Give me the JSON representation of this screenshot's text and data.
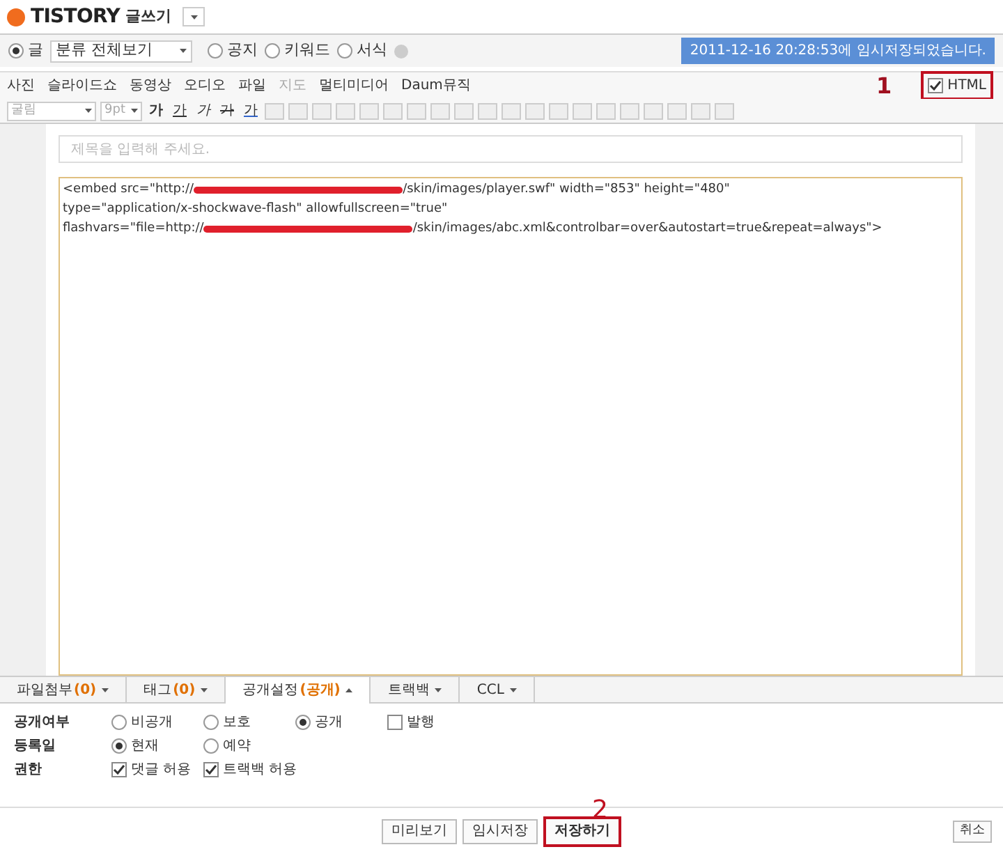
{
  "header": {
    "logo": "TISTORY",
    "title": "글쓰기"
  },
  "post_type": [
    {
      "label": "글",
      "selected": true
    },
    {
      "label": "공지",
      "selected": false
    },
    {
      "label": "키워드",
      "selected": false
    },
    {
      "label": "서식",
      "selected": false
    }
  ],
  "category": {
    "value": "분류 전체보기"
  },
  "save_notice": "2011-12-16 20:28:53에 임시저장되었습니다.",
  "media_toolbar": [
    "사진",
    "슬라이드쇼",
    "동영상",
    "오디오",
    "파일",
    "지도",
    "멀티미디어",
    "Daum뮤직"
  ],
  "html_toggle": {
    "label": "HTML",
    "checked": true
  },
  "format_toolbar": {
    "font": "굴림",
    "size": "9pt",
    "styles": [
      {
        "kind": "bold",
        "label": "가"
      },
      {
        "kind": "underline",
        "label": "가"
      },
      {
        "kind": "italic",
        "label": "가"
      },
      {
        "kind": "strike",
        "label": "가"
      },
      {
        "kind": "color",
        "label": "가"
      }
    ]
  },
  "title_field": {
    "placeholder": "제목을 입력해 주세요."
  },
  "code_lines": [
    [
      {
        "kind": "text",
        "text": "<embed src=\"http://"
      },
      {
        "kind": "redacted"
      },
      {
        "kind": "text",
        "text": "/skin/images/player.swf\" width=\"853\" height=\"480\""
      }
    ],
    [
      {
        "kind": "text",
        "text": "type=\"application/x-shockwave-flash\" allowfullscreen=\"true\""
      }
    ],
    [
      {
        "kind": "text",
        "text": "flashvars=\"file=http://"
      },
      {
        "kind": "redacted"
      },
      {
        "kind": "text",
        "text": "/skin/images/abc.xml&controlbar=over&autostart=true&repeat=always\">"
      }
    ]
  ],
  "tabs": [
    {
      "label": "파일첨부",
      "count": "(0)",
      "selected": false
    },
    {
      "label": "태그",
      "count": "(0)",
      "selected": false
    },
    {
      "label": "공개설정",
      "count": "(공개)",
      "selected": true
    },
    {
      "label": "트랙백",
      "selected": false
    },
    {
      "label": "CCL",
      "selected": false
    }
  ],
  "settings": [
    {
      "label": "공개여부",
      "options": [
        {
          "kind": "radio",
          "label": "비공개",
          "checked": false
        },
        {
          "kind": "radio",
          "label": "보호",
          "checked": false
        },
        {
          "kind": "radio",
          "label": "공개",
          "checked": true
        },
        {
          "kind": "checkbox",
          "label": "발행",
          "checked": false
        }
      ]
    },
    {
      "label": "등록일",
      "options": [
        {
          "kind": "radio",
          "label": "현재",
          "checked": true
        },
        {
          "kind": "radio",
          "label": "예약",
          "checked": false
        }
      ]
    },
    {
      "label": "권한",
      "options": [
        {
          "kind": "checkbox",
          "label": "댓글 허용",
          "checked": true
        },
        {
          "kind": "checkbox",
          "label": "트랙백 허용",
          "checked": true
        }
      ]
    }
  ],
  "buttons": [
    {
      "label": "미리보기",
      "primary": false
    },
    {
      "label": "임시저장",
      "primary": false
    },
    {
      "label": "저장하기",
      "primary": true
    }
  ],
  "cancel_button": "취소",
  "annotations": [
    "1",
    "2"
  ]
}
